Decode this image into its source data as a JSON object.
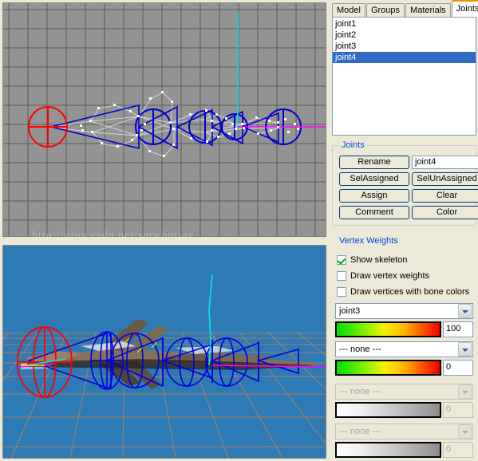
{
  "tabs": [
    {
      "label": "Model",
      "active": false
    },
    {
      "label": "Groups",
      "active": false
    },
    {
      "label": "Materials",
      "active": false
    },
    {
      "label": "Joints",
      "active": true
    }
  ],
  "joint_list": [
    {
      "label": "joint1",
      "selected": false
    },
    {
      "label": "joint2",
      "selected": false
    },
    {
      "label": "joint3",
      "selected": false
    },
    {
      "label": "joint4",
      "selected": true
    }
  ],
  "joints_group": {
    "title": "Joints",
    "rename_label": "Rename",
    "name_value": "joint4",
    "sel_assigned_label": "SelAssigned",
    "sel_unassigned_label": "SelUnAssigned",
    "assign_label": "Assign",
    "clear_label": "Clear",
    "comment_label": "Comment",
    "color_label": "Color"
  },
  "vertex_weights": {
    "title": "Vertex Weights",
    "show_skeleton": {
      "label": "Show skeleton",
      "checked": true
    },
    "draw_vertex_weights": {
      "label": "Draw vertex weights",
      "checked": false
    },
    "draw_vertices_bone_colors": {
      "label": "Draw vertices with bone colors",
      "checked": false
    },
    "slots": [
      {
        "combo_value": "joint3",
        "weight": "100",
        "disabled": false,
        "gradient": "color"
      },
      {
        "combo_value": "--- none ---",
        "weight": "0",
        "disabled": false,
        "gradient": "color"
      },
      {
        "combo_value": "--- none ---",
        "weight": "0",
        "disabled": true,
        "gradient": "gray"
      },
      {
        "combo_value": "--- none ---",
        "weight": "0",
        "disabled": true,
        "gradient": "gray"
      }
    ]
  },
  "watermark": {
    "text": "http://blog.csdn.net/smwhotjay"
  },
  "viewports": {
    "top": {
      "name": "orthographic-front-view",
      "background": "#949494",
      "grid_color": "#5a5a5a"
    },
    "bottom": {
      "name": "perspective-3d-view",
      "background": "#2e7ab4",
      "ground_color": "#b08060"
    }
  },
  "colors": {
    "accent_tab": "#f29100",
    "selection": "#316ac5",
    "panel": "#ece9d8",
    "joint_selected": "#ff0000",
    "bone": "#0000ff",
    "axis_y": "#00ffff",
    "axis_x": "#ff00ff",
    "vertex": "#ffffff"
  }
}
